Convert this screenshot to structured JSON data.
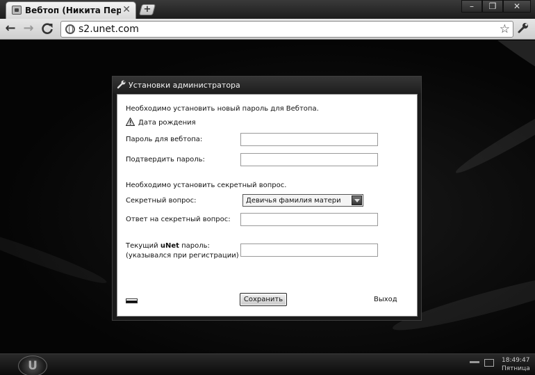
{
  "browser": {
    "tab_title": "Вебтоп (Никита Перепели",
    "tab_close": "✕",
    "new_tab": "+",
    "window_buttons": [
      "–",
      "❐",
      "✕"
    ],
    "nav": {
      "back": "←",
      "forward": "→",
      "reload": "C"
    },
    "address": "s2.unet.com",
    "star": "☆",
    "wrench": "🔧"
  },
  "dialog": {
    "title": "Установки администратора",
    "title_icon": "wrench-icon",
    "notice_password": "Необходимо установить новый пароль для Вебтопа.",
    "warning_text": "Дата рождения",
    "label_password": "Пароль для вебтопа:",
    "label_confirm": "Подтвердить пароль:",
    "notice_secret": "Необходимо установить секретный вопрос.",
    "label_question": "Секретный вопрос:",
    "question_selected": "Девичья фамилия матери",
    "label_answer": "Ответ на секретный вопрос:",
    "label_current_prefix": "Текущий ",
    "label_current_brand": "uNet",
    "label_current_suffix": " пароль:",
    "label_current_note": "(указывался при регистрации)",
    "save_label": "Сохранить",
    "exit_label": "Выход"
  },
  "taskbar": {
    "start_logo": "U",
    "time": "18:49:47",
    "day": "Пятница"
  }
}
